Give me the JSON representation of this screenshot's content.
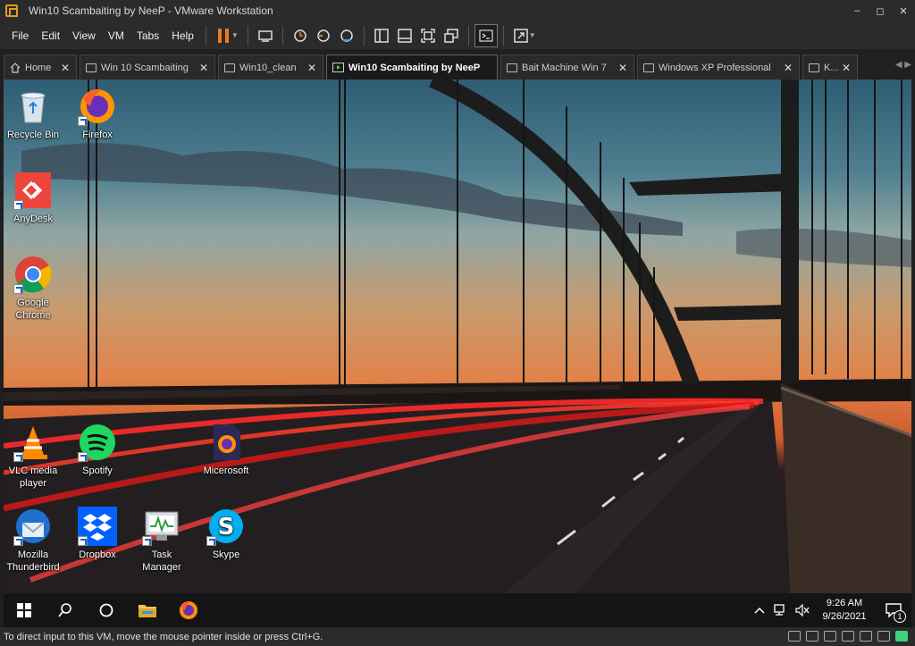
{
  "window": {
    "title": "Win10 Scambaiting by NeeP - VMware Workstation",
    "controls": {
      "minimize": "–",
      "maximize": "◻",
      "close": "✕"
    }
  },
  "menu": [
    "File",
    "Edit",
    "View",
    "VM",
    "Tabs",
    "Help"
  ],
  "tabs": [
    {
      "label": "Home",
      "icon": "home-icon"
    },
    {
      "label": "Win 10 Scambaiting",
      "icon": "vm-icon"
    },
    {
      "label": "Win10_clean",
      "icon": "vm-icon"
    },
    {
      "label": "Win10 Scambaiting by NeeP",
      "icon": "vm-running-icon",
      "active": true
    },
    {
      "label": "Bait Machine Win 7",
      "icon": "vm-icon"
    },
    {
      "label": "Windows XP Professional",
      "icon": "vm-icon"
    },
    {
      "label": "K...",
      "icon": "vm-icon"
    }
  ],
  "tab_close": "✕",
  "desktop_icons": [
    {
      "label": "Recycle Bin",
      "icon": "recycle-bin-icon"
    },
    {
      "label": "Firefox",
      "icon": "firefox-icon"
    },
    {
      "label": "AnyDesk",
      "icon": "anydesk-icon"
    },
    {
      "label": "Google Chrome",
      "icon": "chrome-icon"
    },
    {
      "label": "VLC media player",
      "icon": "vlc-icon"
    },
    {
      "label": "Spotify",
      "icon": "spotify-icon"
    },
    {
      "label": "Micerosoft",
      "icon": "firefox-file-icon"
    },
    {
      "label": "Mozilla Thunderbird",
      "icon": "thunderbird-icon"
    },
    {
      "label": "Dropbox",
      "icon": "dropbox-icon"
    },
    {
      "label": "Task Manager",
      "icon": "task-manager-icon"
    },
    {
      "label": "Skype",
      "icon": "skype-icon"
    }
  ],
  "taskbar": {
    "time": "9:26 AM",
    "date": "9/26/2021",
    "notification_count": "1"
  },
  "status": {
    "message": "To direct input to this VM, move the mouse pointer inside or press Ctrl+G."
  },
  "colors": {
    "pause_orange": "#f07a1a",
    "vmware_orange": "#e39b1c"
  }
}
